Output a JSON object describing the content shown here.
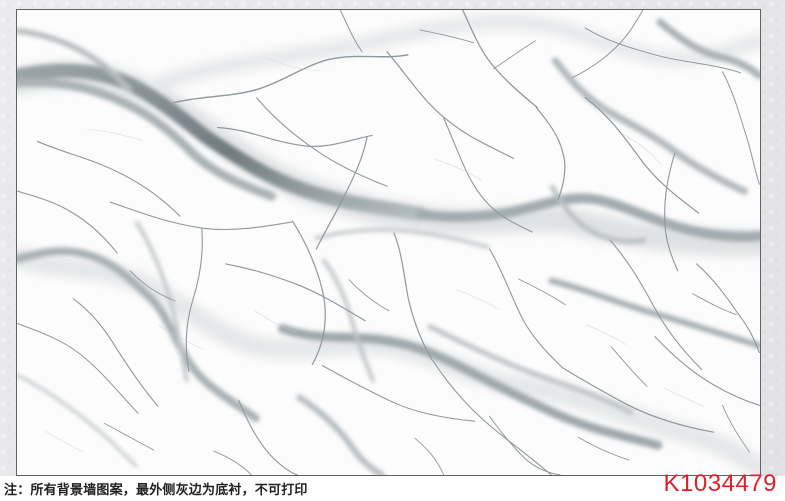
{
  "footer": {
    "note": "注：所有背景墙图案，最外侧灰边为底衬，不可打印",
    "code": "K1034479"
  }
}
